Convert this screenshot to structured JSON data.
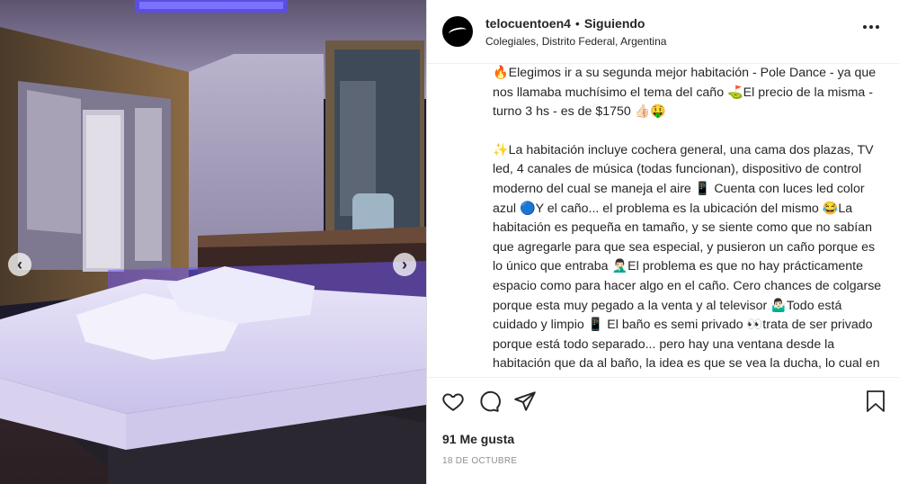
{
  "header": {
    "username": "telocuentoen4",
    "separator": "•",
    "follow_status": "Siguiendo",
    "location": "Colegiales, Distrito Federal, Argentina"
  },
  "caption": {
    "paragraph1": "🔥Elegimos ir a su segunda mejor habitación - Pole Dance - ya que nos llamaba muchísimo el tema del caño ⛳El precio de la misma - turno 3 hs - es de $1750 👍🏻🤑",
    "paragraph2": "✨La habitación incluye cochera general, una cama dos plazas, TV led, 4 canales de música (todas funcionan), dispositivo de control moderno del cual se maneja el aire 📱 Cuenta con luces led color azul 🔵Y el caño... el problema es la ubicación del mismo 😂La habitación es pequeña en tamaño, y se siente como que no sabían que agregarle para que sea especial, y pusieron un caño porque es lo único que entraba 🤦🏻‍♂️El problema es que no hay prácticamente espacio como para hacer algo en el caño. Cero chances de colgarse porque esta muy pegado a la venta y al televisor 🤷🏻‍♂️Todo está cuidado y limpio 📱 El baño es semi privado 👀trata de ser privado porque está todo separado... pero hay una ventana desde la habitación que da al baño, la idea es que se vea la ducha, lo cual en principio es atractivo pero detrás de la ducha está el inodoro 🚽y ahí deja de"
  },
  "icons": {
    "like": "heart-icon",
    "comment": "comment-icon",
    "share": "paper-plane-icon",
    "save": "bookmark-icon",
    "more": "more-options-icon",
    "prev": "chevron-left-icon",
    "next": "chevron-right-icon"
  },
  "likes": "91 Me gusta",
  "date": "18 DE OCTUBRE",
  "colors": {
    "text": "#262626",
    "muted": "#8e8e8e",
    "border": "#efefef",
    "led": "#6b56f0"
  }
}
